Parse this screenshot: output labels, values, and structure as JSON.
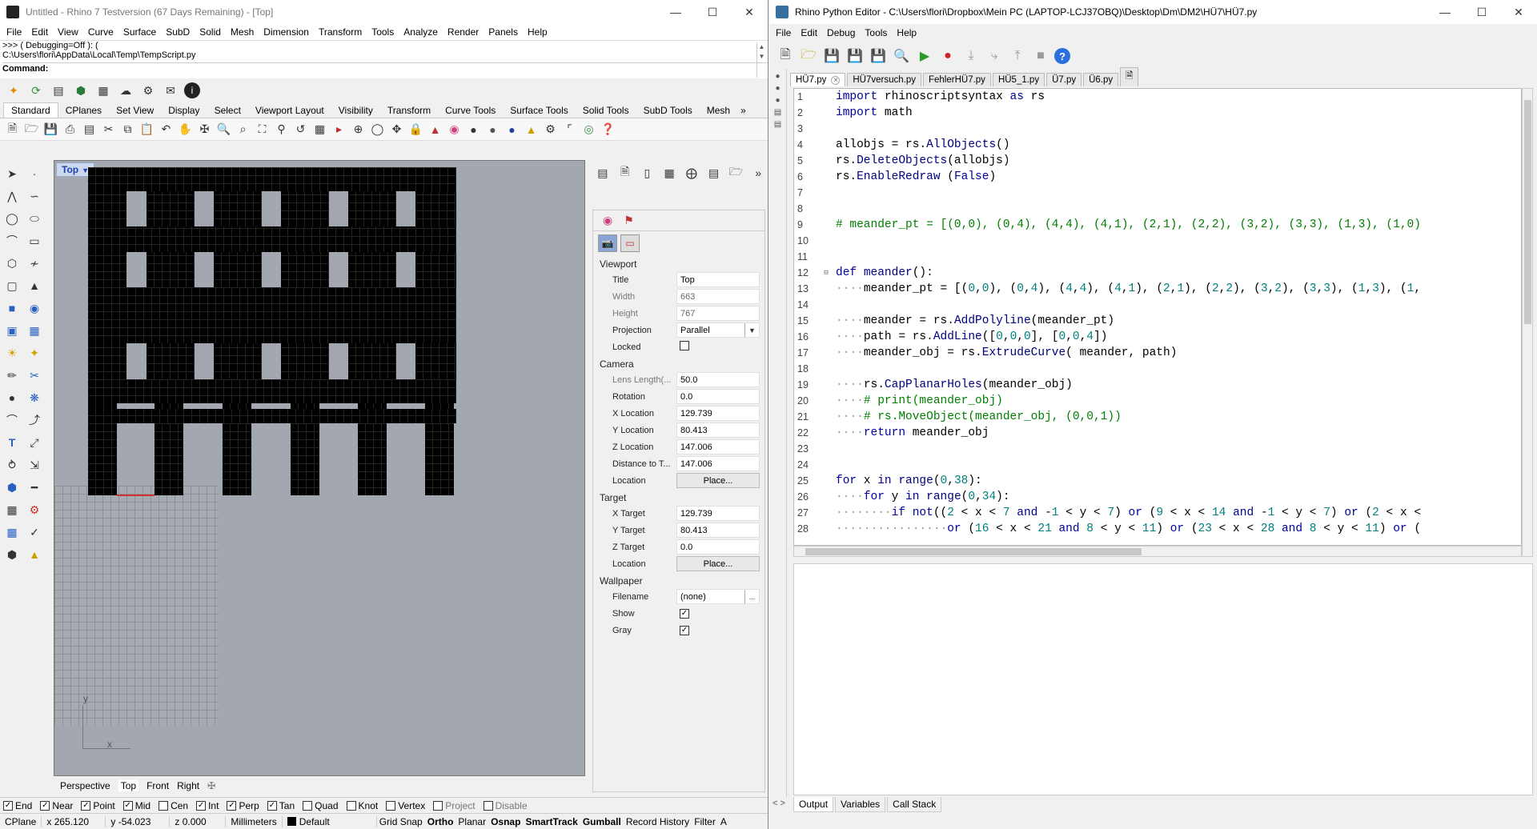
{
  "rhino": {
    "title": "Untitled - Rhino 7 Testversion (67 Days Remaining) - [Top]",
    "menu": [
      "File",
      "Edit",
      "View",
      "Curve",
      "Surface",
      "SubD",
      "Solid",
      "Mesh",
      "Dimension",
      "Transform",
      "Tools",
      "Analyze",
      "Render",
      "Panels",
      "Help"
    ],
    "cmd_history": [
      ">>> ( Debugging=Off ): (",
      "C:\\Users\\flori\\AppData\\Local\\Temp\\TempScript.py"
    ],
    "cmd_prompt": "Command:",
    "toolbar_tabs": [
      "Standard",
      "CPlanes",
      "Set View",
      "Display",
      "Select",
      "Viewport Layout",
      "Visibility",
      "Transform",
      "Curve Tools",
      "Surface Tools",
      "Solid Tools",
      "SubD Tools",
      "Mesh"
    ],
    "viewport": {
      "label": "Top",
      "axis_x": "x",
      "axis_y": "y"
    },
    "viewport_tabs": [
      "Perspective",
      "Top",
      "Front",
      "Right"
    ],
    "panel": {
      "viewport_section": "Viewport",
      "title_label": "Title",
      "title_value": "Top",
      "width_label": "Width",
      "width_value": "663",
      "height_label": "Height",
      "height_value": "767",
      "projection_label": "Projection",
      "projection_value": "Parallel",
      "locked_label": "Locked",
      "locked": false,
      "camera_section": "Camera",
      "lens_label": "Lens Length(...",
      "lens_value": "50.0",
      "rotation_label": "Rotation",
      "rotation_value": "0.0",
      "xloc_label": "X Location",
      "xloc_value": "129.739",
      "yloc_label": "Y Location",
      "yloc_value": "80.413",
      "zloc_label": "Z Location",
      "zloc_value": "147.006",
      "dist_label": "Distance to T...",
      "dist_value": "147.006",
      "location_label": "Location",
      "place_button": "Place...",
      "target_section": "Target",
      "xt_label": "X Target",
      "xt_value": "129.739",
      "yt_label": "Y Target",
      "yt_value": "80.413",
      "zt_label": "Z Target",
      "zt_value": "0.0",
      "tloc_label": "Location",
      "wallpaper_section": "Wallpaper",
      "filename_label": "Filename",
      "filename_value": "(none)",
      "browse": "...",
      "show_label": "Show",
      "show": true,
      "gray_label": "Gray",
      "gray": true
    },
    "osnaps": [
      {
        "label": "End",
        "checked": true
      },
      {
        "label": "Near",
        "checked": true
      },
      {
        "label": "Point",
        "checked": true
      },
      {
        "label": "Mid",
        "checked": true
      },
      {
        "label": "Cen",
        "checked": false
      },
      {
        "label": "Int",
        "checked": true
      },
      {
        "label": "Perp",
        "checked": true
      },
      {
        "label": "Tan",
        "checked": true
      },
      {
        "label": "Quad",
        "checked": false
      },
      {
        "label": "Knot",
        "checked": false
      },
      {
        "label": "Vertex",
        "checked": false
      },
      {
        "label": "Project",
        "checked": false,
        "disabled": true
      },
      {
        "label": "Disable",
        "checked": false,
        "disabled": true
      }
    ],
    "status": {
      "cplane": "CPlane",
      "x": "x 265.120",
      "y": "y -54.023",
      "z": "z 0.000",
      "units": "Millimeters",
      "layer": "Default",
      "toggles": [
        "Grid Snap",
        "Ortho",
        "Planar",
        "Osnap",
        "SmartTrack",
        "Gumball",
        "Record History",
        "Filter",
        "A"
      ]
    }
  },
  "pyeditor": {
    "title": "Rhino Python Editor - C:\\Users\\flori\\Dropbox\\Mein PC (LAPTOP-LCJ37OBQ)\\Desktop\\Dm\\DM2\\HÜ7\\HÜ7.py",
    "menu": [
      "File",
      "Edit",
      "Debug",
      "Tools",
      "Help"
    ],
    "file_tabs": [
      "HÜ7.py",
      "HÜ7versuch.py",
      "FehlerHÜ7.py",
      "HÜ5_1.py",
      "Ü7.py",
      "Ü6.py"
    ],
    "code_lines": [
      "1",
      "2",
      "3",
      "4",
      "5",
      "6",
      "7",
      "8",
      "9",
      "10",
      "11",
      "12",
      "13",
      "14",
      "15",
      "16",
      "17",
      "18",
      "19",
      "20",
      "21",
      "22",
      "23",
      "24",
      "25",
      "26",
      "27",
      "28"
    ],
    "output_tabs": [
      "Output",
      "Variables",
      "Call Stack"
    ]
  },
  "colors": {
    "accent": "#2a6fdb",
    "code_keyword": "#00009c",
    "comment": "#007f00",
    "number": "#007f7f"
  }
}
